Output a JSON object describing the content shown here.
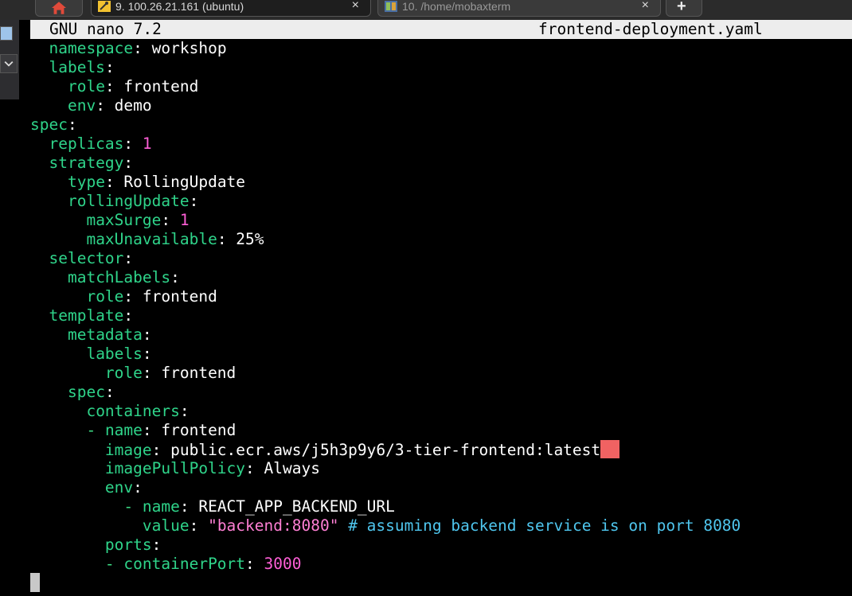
{
  "tabs": {
    "active": {
      "label": "9. 100.26.21.161 (ubuntu)"
    },
    "inactive": {
      "label": "10. /home/mobaxterm"
    },
    "close_glyph": "×",
    "new_tab_glyph": "+"
  },
  "titlebar": {
    "app": "GNU nano 7.2",
    "filename": "frontend-deployment.yaml"
  },
  "colors": {
    "key": "#2fd48a",
    "number": "#ff5fd7",
    "string": "#ff7fd4",
    "comment": "#4fc6ee",
    "cursor": "#f06262"
  },
  "lines": [
    [
      {
        "t": "  "
      },
      {
        "t": "namespace",
        "c": "k"
      },
      {
        "t": ": workshop"
      }
    ],
    [
      {
        "t": "  "
      },
      {
        "t": "labels",
        "c": "k"
      },
      {
        "t": ":"
      }
    ],
    [
      {
        "t": "    "
      },
      {
        "t": "role",
        "c": "k"
      },
      {
        "t": ": frontend"
      }
    ],
    [
      {
        "t": "    "
      },
      {
        "t": "env",
        "c": "k"
      },
      {
        "t": ": demo"
      }
    ],
    [
      {
        "t": "spec",
        "c": "k"
      },
      {
        "t": ":"
      }
    ],
    [
      {
        "t": "  "
      },
      {
        "t": "replicas",
        "c": "k"
      },
      {
        "t": ": "
      },
      {
        "t": "1",
        "c": "n"
      }
    ],
    [
      {
        "t": "  "
      },
      {
        "t": "strategy",
        "c": "k"
      },
      {
        "t": ":"
      }
    ],
    [
      {
        "t": "    "
      },
      {
        "t": "type",
        "c": "k"
      },
      {
        "t": ": RollingUpdate"
      }
    ],
    [
      {
        "t": "    "
      },
      {
        "t": "rollingUpdate",
        "c": "k"
      },
      {
        "t": ":"
      }
    ],
    [
      {
        "t": "      "
      },
      {
        "t": "maxSurge",
        "c": "k"
      },
      {
        "t": ": "
      },
      {
        "t": "1",
        "c": "n"
      }
    ],
    [
      {
        "t": "      "
      },
      {
        "t": "maxUnavailable",
        "c": "k"
      },
      {
        "t": ": 25%"
      }
    ],
    [
      {
        "t": "  "
      },
      {
        "t": "selector",
        "c": "k"
      },
      {
        "t": ":"
      }
    ],
    [
      {
        "t": "    "
      },
      {
        "t": "matchLabels",
        "c": "k"
      },
      {
        "t": ":"
      }
    ],
    [
      {
        "t": "      "
      },
      {
        "t": "role",
        "c": "k"
      },
      {
        "t": ": frontend"
      }
    ],
    [
      {
        "t": "  "
      },
      {
        "t": "template",
        "c": "k"
      },
      {
        "t": ":"
      }
    ],
    [
      {
        "t": "    "
      },
      {
        "t": "metadata",
        "c": "k"
      },
      {
        "t": ":"
      }
    ],
    [
      {
        "t": "      "
      },
      {
        "t": "labels",
        "c": "k"
      },
      {
        "t": ":"
      }
    ],
    [
      {
        "t": "        "
      },
      {
        "t": "role",
        "c": "k"
      },
      {
        "t": ": frontend"
      }
    ],
    [
      {
        "t": "    "
      },
      {
        "t": "spec",
        "c": "k"
      },
      {
        "t": ":"
      }
    ],
    [
      {
        "t": "      "
      },
      {
        "t": "containers",
        "c": "k"
      },
      {
        "t": ":"
      }
    ],
    [
      {
        "t": "      "
      },
      {
        "t": "- ",
        "c": "d"
      },
      {
        "t": "name",
        "c": "k"
      },
      {
        "t": ": frontend"
      }
    ],
    [
      {
        "t": "        "
      },
      {
        "t": "image",
        "c": "k"
      },
      {
        "t": ": public.ecr.aws/j5h3p9y6/3-tier-frontend:latest"
      },
      {
        "t": "",
        "c": "cursor"
      }
    ],
    [
      {
        "t": "        "
      },
      {
        "t": "imagePullPolicy",
        "c": "k"
      },
      {
        "t": ": Always"
      }
    ],
    [
      {
        "t": "        "
      },
      {
        "t": "env",
        "c": "k"
      },
      {
        "t": ":"
      }
    ],
    [
      {
        "t": "          "
      },
      {
        "t": "- ",
        "c": "d"
      },
      {
        "t": "name",
        "c": "k"
      },
      {
        "t": ": REACT_APP_BACKEND_URL"
      }
    ],
    [
      {
        "t": "            "
      },
      {
        "t": "value",
        "c": "k"
      },
      {
        "t": ": "
      },
      {
        "t": "\"backend:8080\"",
        "c": "s"
      },
      {
        "t": " "
      },
      {
        "t": "# assuming backend service is on port 8080",
        "c": "c"
      }
    ],
    [
      {
        "t": "        "
      },
      {
        "t": "ports",
        "c": "k"
      },
      {
        "t": ":"
      }
    ],
    [
      {
        "t": "        "
      },
      {
        "t": "- ",
        "c": "d"
      },
      {
        "t": "containerPort",
        "c": "k"
      },
      {
        "t": ": "
      },
      {
        "t": "3000",
        "c": "n"
      }
    ]
  ]
}
